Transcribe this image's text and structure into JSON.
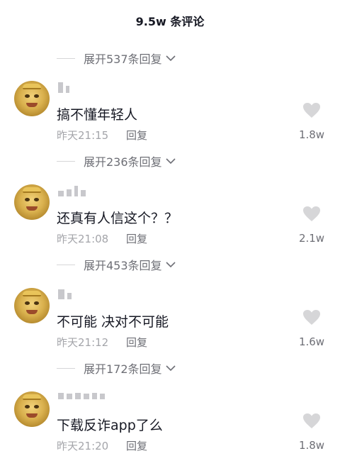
{
  "header": {
    "title": "9.5w 条评论"
  },
  "comments": [
    {
      "expand_label": "展开537条回复",
      "text": "搞不懂年轻人",
      "time": "昨天21:15",
      "reply_label": "回复",
      "likes": "1.8w"
    },
    {
      "expand_label": "展开236条回复",
      "text": "还真有人信这个？？",
      "time": "昨天21:08",
      "reply_label": "回复",
      "likes": "2.1w"
    },
    {
      "expand_label": "展开453条回复",
      "text": "不可能 决对不可能",
      "time": "昨天21:12",
      "reply_label": "回复",
      "likes": "1.6w"
    },
    {
      "expand_label": "展开172条回复",
      "text": "下载反诈app了么",
      "time": "昨天21:20",
      "reply_label": "回复",
      "likes": "1.8w"
    }
  ],
  "icons": {
    "heart": "heart-icon",
    "chevron": "chevron-down-icon",
    "avatar": "avatar"
  },
  "colors": {
    "text_primary": "#161823",
    "text_secondary": "#a4a5aa",
    "heart": "#d6d6d8"
  }
}
